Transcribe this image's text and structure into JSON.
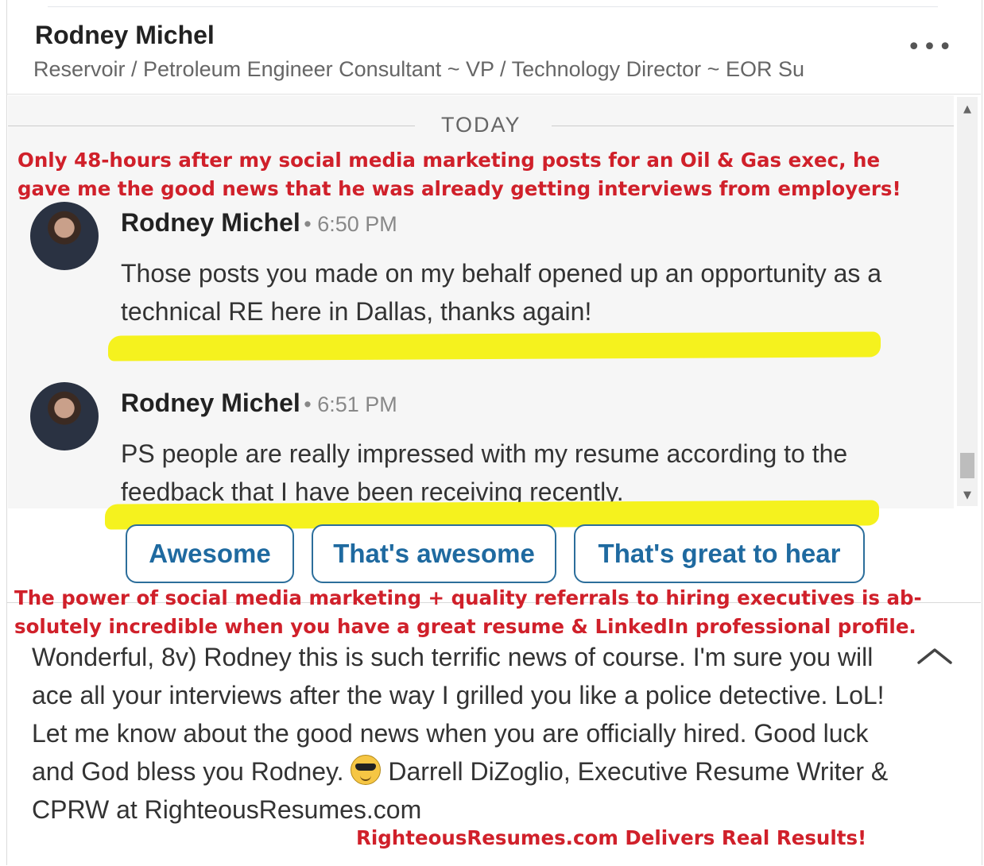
{
  "header": {
    "name": "Rodney Michel",
    "headline": "Reservoir / Petroleum Engineer Consultant ~ VP / Technology Director ~ EOR Su",
    "more_icon": "ellipsis-icon"
  },
  "thread": {
    "date_divider": "TODAY",
    "messages": [
      {
        "sender": "Rodney Michel",
        "time": "• 6:50 PM",
        "text": "Those posts you made on my behalf opened up an opportunity as a technical RE here in Dallas, thanks again!"
      },
      {
        "sender": "Rodney Michel",
        "time": "• 6:51 PM",
        "text": "PS people are really impressed with my resume according to the feedback that I have been receiving recently."
      }
    ]
  },
  "annotations": {
    "top_line1": "Only 48-hours after my social media marketing posts for an Oil & Gas exec, he",
    "top_line2": "gave me the good news that he was already getting interviews from employers!",
    "mid_line1": "The power of social media marketing + quality referrals to hiring executives is ab-",
    "mid_line2": "solutely incredible when you have a great resume & LinkedIn professional profile.",
    "bottom": "RighteousResumes.com Delivers Real Results!"
  },
  "smart_replies": [
    "Awesome",
    "That's awesome",
    "That's great to hear"
  ],
  "compose": {
    "text_part1": "Wonderful, 8v) Rodney this is such terrific news of course. I'm sure you will ace all your interviews after the way I grilled you like a police detective. LoL! Let me know about the good news when you are officially hired. Good luck and God bless you Rodney.",
    "emoji": "sunglasses-emoji",
    "text_part2": "Darrell DiZoglio, Executive Resume Writer & CPRW at RighteousResumes.com"
  },
  "colors": {
    "annotation_red": "#d0202a",
    "highlight_yellow": "#f5f21e",
    "chip_blue": "#1f6aa0"
  }
}
